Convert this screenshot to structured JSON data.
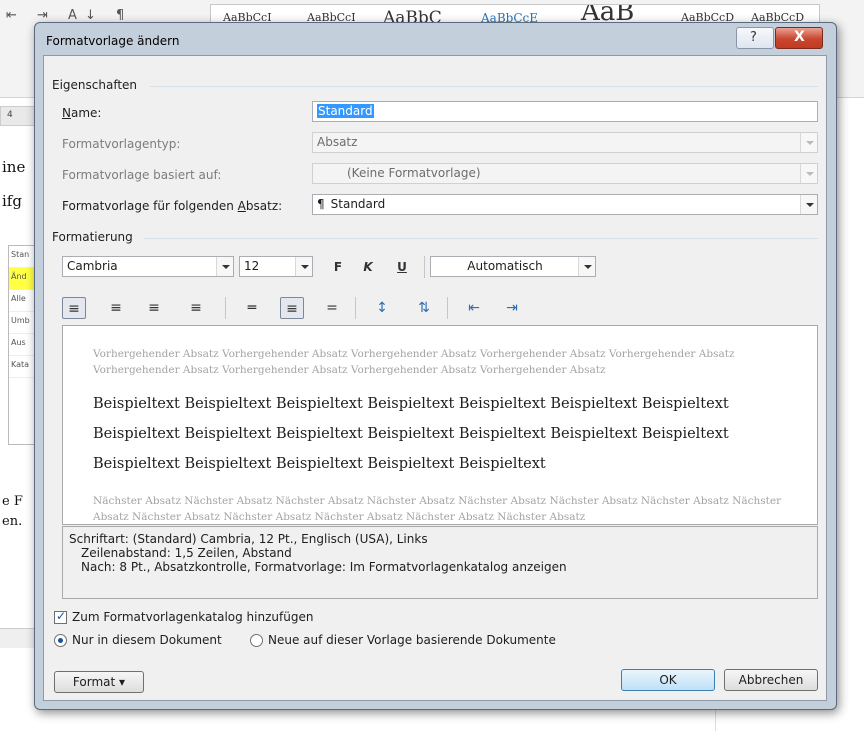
{
  "background": {
    "ribbon_icons": "⇤ ⇥ A↓ ¶",
    "gallery_samples": [
      "AaBbCcI",
      "AaBbCcI",
      "AaBbC",
      "AaBbCcE",
      "AaB",
      "AaBbCcD",
      "AaBbCcD"
    ],
    "ruler_label": "4",
    "doc_fragments": [
      "ine",
      "ifg",
      "e F",
      "en."
    ],
    "style_pane_items": [
      "Stan",
      "Änd",
      "Alle",
      "Umb",
      "Aus",
      "Kata"
    ]
  },
  "dialog": {
    "title": "Formatvorlage ändern",
    "help_label": "?",
    "close_label": "X"
  },
  "properties": {
    "section_label": "Eigenschaften",
    "name": {
      "label": "Name:",
      "value": "Standard"
    },
    "type": {
      "label": "Formatvorlagentyp:",
      "value": "Absatz"
    },
    "based_on": {
      "label": "Formatvorlage basiert auf:",
      "value": "(Keine Formatvorlage)"
    },
    "next": {
      "label": "Formatvorlage für folgenden Absatz:",
      "value": "Standard",
      "icon": "¶"
    }
  },
  "formatting": {
    "section_label": "Formatierung",
    "font": "Cambria",
    "size": "12",
    "bold": "F",
    "italic": "K",
    "underline": "U",
    "color": "Automatisch"
  },
  "preview": {
    "previous_text": "Vorhergehender Absatz Vorhergehender Absatz Vorhergehender Absatz Vorhergehender Absatz Vorhergehender Absatz Vorhergehender Absatz Vorhergehender Absatz Vorhergehender Absatz Vorhergehender Absatz",
    "sample_lines": [
      "Beispieltext Beispieltext Beispieltext Beispieltext Beispieltext Beispieltext Beispieltext",
      "Beispieltext Beispieltext Beispieltext Beispieltext Beispieltext Beispieltext Beispieltext",
      "Beispieltext Beispieltext Beispieltext Beispieltext Beispieltext"
    ],
    "next_text": "Nächster Absatz Nächster Absatz Nächster Absatz Nächster Absatz Nächster Absatz Nächster Absatz Nächster Absatz Nächster Absatz Nächster Absatz Nächster Absatz Nächster Absatz Nächster Absatz Nächster Absatz"
  },
  "description": [
    "Schriftart: (Standard) Cambria, 12 Pt., Englisch (USA), Links",
    "Zeilenabstand:  1,5 Zeilen, Abstand",
    "Nach:  8 Pt., Absatzkontrolle, Formatvorlage: Im Formatvorlagenkatalog anzeigen"
  ],
  "options": {
    "add_to_gallery": {
      "label": "Zum Formatvorlagenkatalog hinzufügen",
      "checked": true
    },
    "only_this_doc": {
      "label": "Nur in diesem Dokument",
      "selected": true
    },
    "new_docs": {
      "label": "Neue auf dieser Vorlage basierende Dokumente",
      "selected": false
    }
  },
  "buttons": {
    "format": "Format",
    "ok": "OK",
    "cancel": "Abbrechen"
  }
}
